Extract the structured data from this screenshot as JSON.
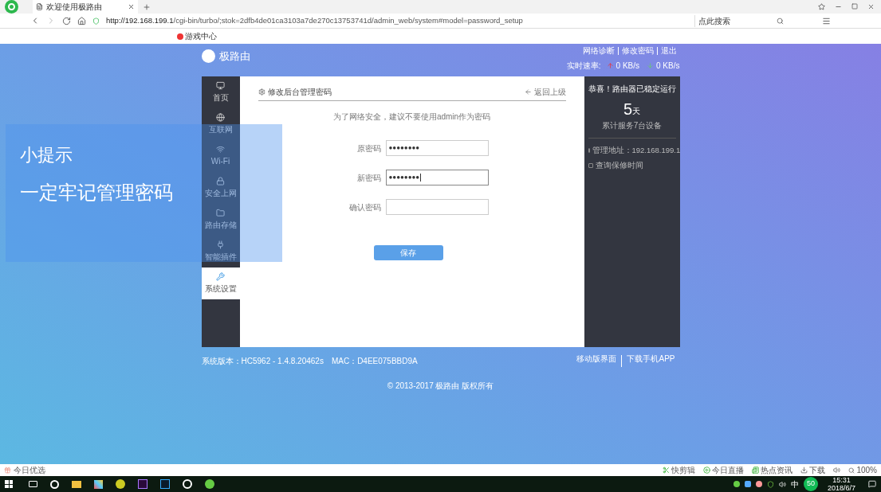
{
  "browser": {
    "tab_title": "欢迎使用极路由",
    "url_host": "http://192.168.199.1",
    "url_path": "/cgi-bin/turbo/;stok=2dfb4de01ca3103a7de270c13753741d/admin_web/system#model=password_setup",
    "search_placeholder": "点此搜索",
    "bookmarks": [
      "游戏中心"
    ]
  },
  "header": {
    "brand": "极路由",
    "links": [
      "网络诊断",
      "修改密码",
      "退出"
    ],
    "speed_label": "实时速率:",
    "upload": "0 KB/s",
    "download": "0 KB/s"
  },
  "sidebar": {
    "items": [
      {
        "label": "首页",
        "selected": false
      },
      {
        "label": "互联网",
        "selected": false
      },
      {
        "label": "Wi-Fi",
        "selected": false
      },
      {
        "label": "安全上网",
        "selected": false
      },
      {
        "label": "路由存储",
        "selected": false
      },
      {
        "label": "智能插件",
        "selected": false
      },
      {
        "label": "系统设置",
        "selected": true
      }
    ]
  },
  "panel": {
    "title": "修改后台管理密码",
    "back": "返回上级",
    "hint": "为了网络安全，建议不要使用admin作为密码",
    "fields": [
      {
        "label": "原密码",
        "value": "●●●●●●●●",
        "focused": false
      },
      {
        "label": "新密码",
        "value": "●●●●●●●●",
        "focused": true
      },
      {
        "label": "确认密码",
        "focused": false
      }
    ],
    "save": "保存"
  },
  "status_panel": {
    "title": "恭喜！路由器已稳定运行",
    "days": "5",
    "unit": "天",
    "served": "累计服务7台设备",
    "info": [
      "管理地址：192.168.199.1",
      "查询保修时间"
    ]
  },
  "footer": {
    "version": "系统版本：HC5962 - 1.4.8.20462s",
    "mac": "MAC：D4EE075BBD9A",
    "links": [
      "移动版界面",
      "下载手机APP"
    ],
    "copyright": "© 2013-2017 极路由 版权所有"
  },
  "tip_overlay": {
    "title": "小提示",
    "message": "一定牢记管理密码"
  },
  "status_bar": {
    "left": "今日优选",
    "right": [
      "快剪辑",
      "今日直播",
      "热点资讯",
      "下载"
    ],
    "zoom": "100%"
  },
  "taskbar": {
    "ime": "中",
    "badge": "50",
    "time": "15:31",
    "date": "2018/6/7"
  }
}
